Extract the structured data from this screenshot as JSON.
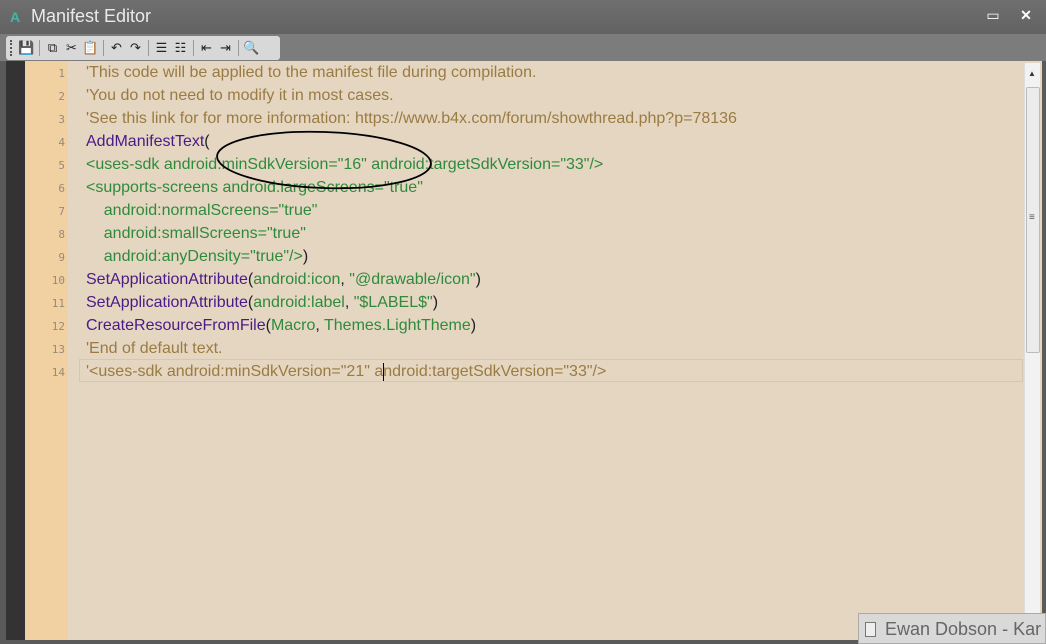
{
  "window": {
    "title": "Manifest Editor",
    "app_icon": "A"
  },
  "toolbar": [
    {
      "name": "save-icon",
      "glyph": "💾"
    },
    {
      "name": "copy-icon",
      "glyph": "⧉"
    },
    {
      "name": "cut-icon",
      "glyph": "✂"
    },
    {
      "name": "paste-icon",
      "glyph": "📋"
    },
    {
      "name": "undo-icon",
      "glyph": "↶"
    },
    {
      "name": "redo-icon",
      "glyph": "↷"
    },
    {
      "name": "comment-icon",
      "glyph": "☰"
    },
    {
      "name": "uncomment-icon",
      "glyph": "☷"
    },
    {
      "name": "outdent-icon",
      "glyph": "⇤"
    },
    {
      "name": "indent-icon",
      "glyph": "⇥"
    },
    {
      "name": "find-icon",
      "glyph": "🔍"
    }
  ],
  "code_lines": [
    {
      "n": "1",
      "segs": [
        {
          "t": "'This code will be applied to the manifest file during compilation.",
          "c": "c"
        }
      ]
    },
    {
      "n": "2",
      "segs": [
        {
          "t": "'You do not need to modify it in most cases.",
          "c": "c"
        }
      ]
    },
    {
      "n": "3",
      "segs": [
        {
          "t": "'See this link for for more information: https://www.b4x.com/forum/showthread.php?p=78136",
          "c": "c"
        }
      ]
    },
    {
      "n": "4",
      "segs": [
        {
          "t": "AddManifestText",
          "c": "k"
        },
        {
          "t": "(",
          "c": "p"
        }
      ]
    },
    {
      "n": "5",
      "segs": [
        {
          "t": "<uses-sdk android:minSdkVersion=\"16\" android:targetSdkVersion=\"33\"/>",
          "c": "s"
        }
      ]
    },
    {
      "n": "6",
      "segs": [
        {
          "t": "<supports-screens android:largeScreens=\"true\"",
          "c": "s"
        }
      ]
    },
    {
      "n": "7",
      "segs": [
        {
          "t": "    android:normalScreens=\"true\"",
          "c": "s"
        }
      ]
    },
    {
      "n": "8",
      "segs": [
        {
          "t": "    android:smallScreens=\"true\"",
          "c": "s"
        }
      ]
    },
    {
      "n": "9",
      "segs": [
        {
          "t": "    android:anyDensity=\"true\"/>",
          "c": "s"
        },
        {
          "t": ")",
          "c": "p"
        }
      ]
    },
    {
      "n": "10",
      "segs": [
        {
          "t": "SetApplicationAttribute",
          "c": "k"
        },
        {
          "t": "(",
          "c": "p"
        },
        {
          "t": "android:icon",
          "c": "s"
        },
        {
          "t": ", ",
          "c": "p"
        },
        {
          "t": "\"@drawable/icon\"",
          "c": "s"
        },
        {
          "t": ")",
          "c": "p"
        }
      ]
    },
    {
      "n": "11",
      "segs": [
        {
          "t": "SetApplicationAttribute",
          "c": "k"
        },
        {
          "t": "(",
          "c": "p"
        },
        {
          "t": "android:label",
          "c": "s"
        },
        {
          "t": ", ",
          "c": "p"
        },
        {
          "t": "\"$LABEL$\"",
          "c": "s"
        },
        {
          "t": ")",
          "c": "p"
        }
      ]
    },
    {
      "n": "12",
      "segs": [
        {
          "t": "CreateResourceFromFile",
          "c": "k"
        },
        {
          "t": "(",
          "c": "p"
        },
        {
          "t": "Macro",
          "c": "s"
        },
        {
          "t": ", ",
          "c": "p"
        },
        {
          "t": "Themes.LightTheme",
          "c": "s"
        },
        {
          "t": ")",
          "c": "p"
        }
      ]
    },
    {
      "n": "13",
      "segs": [
        {
          "t": "'End of default text.",
          "c": "c"
        }
      ]
    },
    {
      "n": "14",
      "segs": [
        {
          "t": "'<uses-sdk android:minSdkVersion=\"21\" a",
          "c": "c"
        },
        {
          "t": "|caret",
          "c": "caret"
        },
        {
          "t": "ndroid:targetSdkVersion=\"33\"/>",
          "c": "c"
        }
      ]
    }
  ],
  "notification": {
    "text": "Ewan Dobson - Kar"
  }
}
